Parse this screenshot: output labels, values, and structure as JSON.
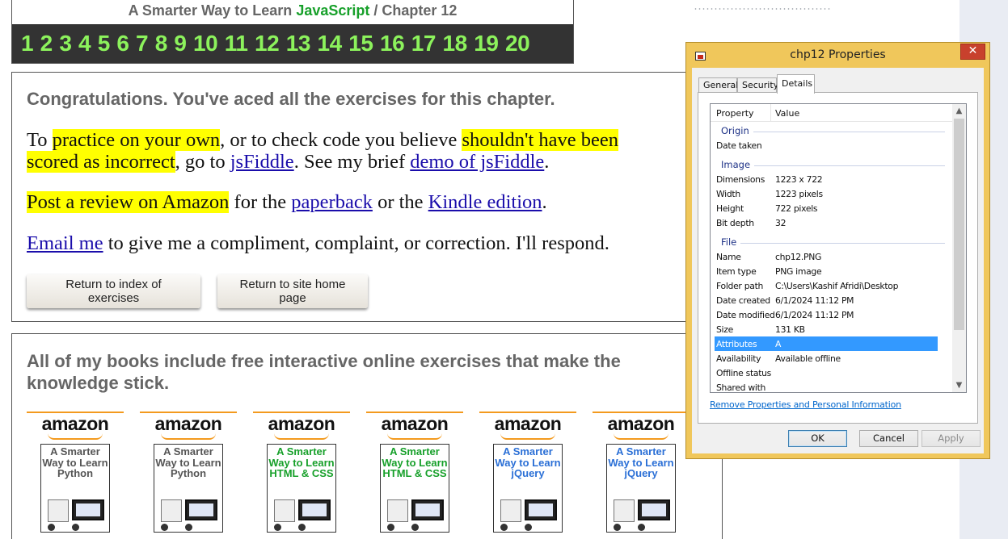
{
  "page": {
    "header": {
      "title_prefix": "A Smarter Way to Learn ",
      "title_js": "JavaScript",
      "title_suffix": " / Chapter 12",
      "chapters": [
        "1",
        "2",
        "3",
        "4",
        "5",
        "6",
        "7",
        "8",
        "9",
        "10",
        "11",
        "12",
        "13",
        "14",
        "15",
        "16",
        "17",
        "18",
        "19",
        "20"
      ]
    },
    "congrats": "Congratulations. You've aced all the exercises for this chapter.",
    "practice": {
      "t1": "To ",
      "h1": "practice on your own",
      "t2": ", or to check code you believe ",
      "h2": "shouldn't have been scored as incorrect",
      "t3": ", go to ",
      "link1": "jsFiddle",
      "t4": ". See my brief ",
      "link2": "demo of jsFiddle",
      "t5": "."
    },
    "review": {
      "h1": "Post a review on Amazon",
      "t1": " for the ",
      "link1": "paperback",
      "t2": " or the ",
      "link2": "Kindle edition",
      "t3": "."
    },
    "email": {
      "link": "Email me",
      "text": " to give me a compliment, complaint, or correction. I'll respond."
    },
    "buttons": {
      "index": "Return to index of exercises",
      "home": "Return to site home page"
    },
    "books_title": "All of my books include free interactive online exercises that make the knowledge stick.",
    "books": [
      {
        "logo": "amazon",
        "title": "A Smarter Way to Learn Python",
        "color": "#555555"
      },
      {
        "logo": "amazon",
        "title": "A Smarter Way to Learn Python",
        "color": "#555555"
      },
      {
        "logo": "amazon",
        "title": "A Smarter Way to Learn HTML & CSS",
        "color": "#17a02a"
      },
      {
        "logo": "amazon",
        "title": "A Smarter Way to Learn HTML & CSS",
        "color": "#17a02a"
      },
      {
        "logo": "amazon",
        "title": "A Smarter Way to Learn jQuery",
        "color": "#2a6fd6"
      },
      {
        "logo": "amazon",
        "title": "A Smarter Way to Learn jQuery",
        "color": "#2a6fd6"
      }
    ]
  },
  "dialog": {
    "title": "chp12 Properties",
    "close": "✕",
    "tabs": [
      "General",
      "Security",
      "Details"
    ],
    "columns": {
      "property": "Property",
      "value": "Value"
    },
    "groups": {
      "origin": "Origin",
      "image": "Image",
      "file": "File"
    },
    "rows": {
      "date_taken": {
        "prop": "Date taken",
        "val": ""
      },
      "dimensions": {
        "prop": "Dimensions",
        "val": "1223 x 722"
      },
      "width": {
        "prop": "Width",
        "val": "1223 pixels"
      },
      "height": {
        "prop": "Height",
        "val": "722 pixels"
      },
      "bit_depth": {
        "prop": "Bit depth",
        "val": "32"
      },
      "name": {
        "prop": "Name",
        "val": "chp12.PNG"
      },
      "item_type": {
        "prop": "Item type",
        "val": "PNG image"
      },
      "folder_path": {
        "prop": "Folder path",
        "val": "C:\\Users\\Kashif Afridi\\Desktop"
      },
      "date_created": {
        "prop": "Date created",
        "val": "6/1/2024 11:12 PM"
      },
      "date_modified": {
        "prop": "Date modified",
        "val": "6/1/2024 11:12 PM"
      },
      "size": {
        "prop": "Size",
        "val": "131 KB"
      },
      "attributes": {
        "prop": "Attributes",
        "val": "A"
      },
      "availability": {
        "prop": "Availability",
        "val": "Available offline"
      },
      "offline_status": {
        "prop": "Offline status",
        "val": ""
      },
      "shared_with": {
        "prop": "Shared with",
        "val": ""
      }
    },
    "remove_link": "Remove Properties and Personal Information",
    "buttons": {
      "ok": "OK",
      "cancel": "Cancel",
      "apply": "Apply"
    }
  }
}
